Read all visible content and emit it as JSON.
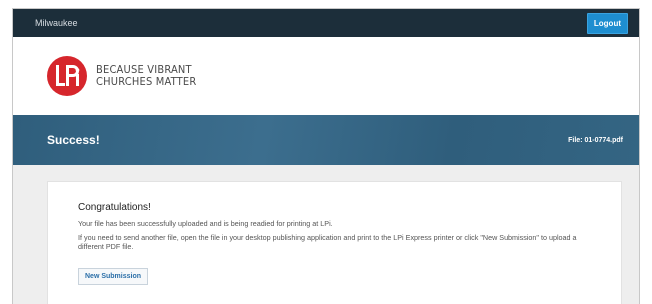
{
  "topbar": {
    "site_name": "Milwaukee",
    "logout_label": "Logout"
  },
  "logo": {
    "mark": "LPi",
    "tagline_line1": "BECAUSE VIBRANT",
    "tagline_line2": "CHURCHES MATTER",
    "brand_color": "#d6262c"
  },
  "banner": {
    "title": "Success!",
    "file_label": "File: 01-0774.pdf"
  },
  "card": {
    "heading": "Congratulations!",
    "message1": "Your file has been successfully uploaded and is being readied for printing at LPi.",
    "message2": "If you need to send another file, open the file in your desktop publishing application and print to the LPi Express printer or click \"New Submission\" to upload a different PDF file.",
    "new_submission_label": "New Submission"
  },
  "colors": {
    "topbar": "#1c2e3a",
    "accent": "#1e8ed0",
    "banner": "#2f5e7c"
  }
}
